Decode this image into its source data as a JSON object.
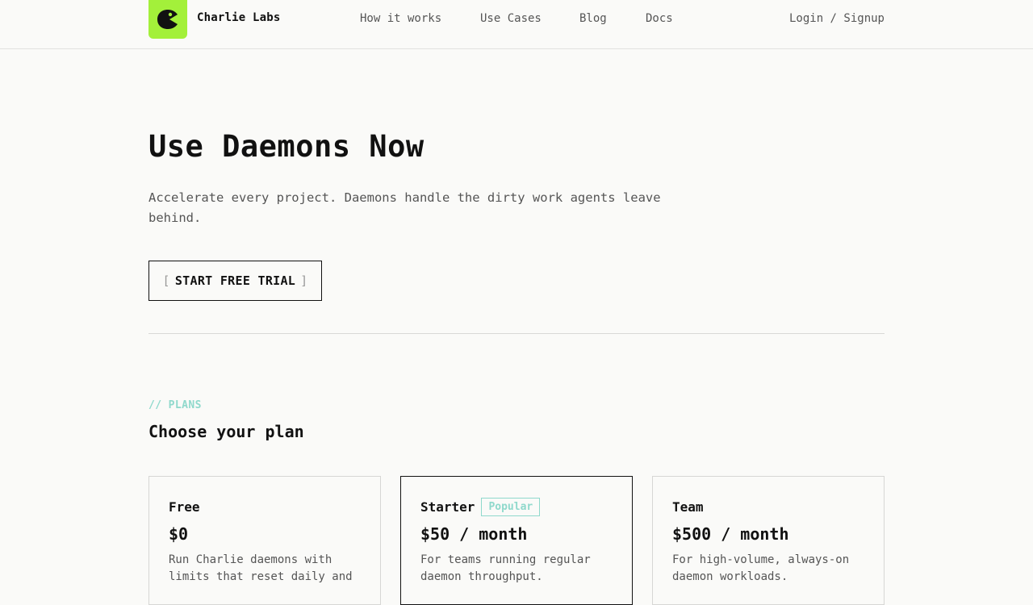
{
  "nav": {
    "brand": "Charlie Labs",
    "links": [
      "How it works",
      "Use Cases",
      "Blog",
      "Docs"
    ],
    "login": "Login / Signup"
  },
  "hero": {
    "title": "Use Daemons Now",
    "subtitle": "Accelerate every project. Daemons handle the dirty work agents leave behind.",
    "cta_label": "START FREE TRIAL",
    "cta_bracket_open": "[",
    "cta_bracket_close": "]"
  },
  "plans": {
    "eyebrow": "// PLANS",
    "title": "Choose your plan",
    "cards": [
      {
        "name": "Free",
        "price": "$0",
        "description": "Run Charlie daemons with limits that reset daily and"
      },
      {
        "name": "Starter",
        "badge": "Popular",
        "price": "$50 / month",
        "description": "For teams running regular daemon throughput."
      },
      {
        "name": "Team",
        "price": "$500 / month",
        "description": "For high-volume, always-on daemon workloads."
      }
    ]
  },
  "colors": {
    "accent_green": "#a3f03a",
    "accent_teal": "#8fd9cc",
    "background": "#fafaf8"
  },
  "icons": {
    "logo": "charlie-logo-icon"
  }
}
